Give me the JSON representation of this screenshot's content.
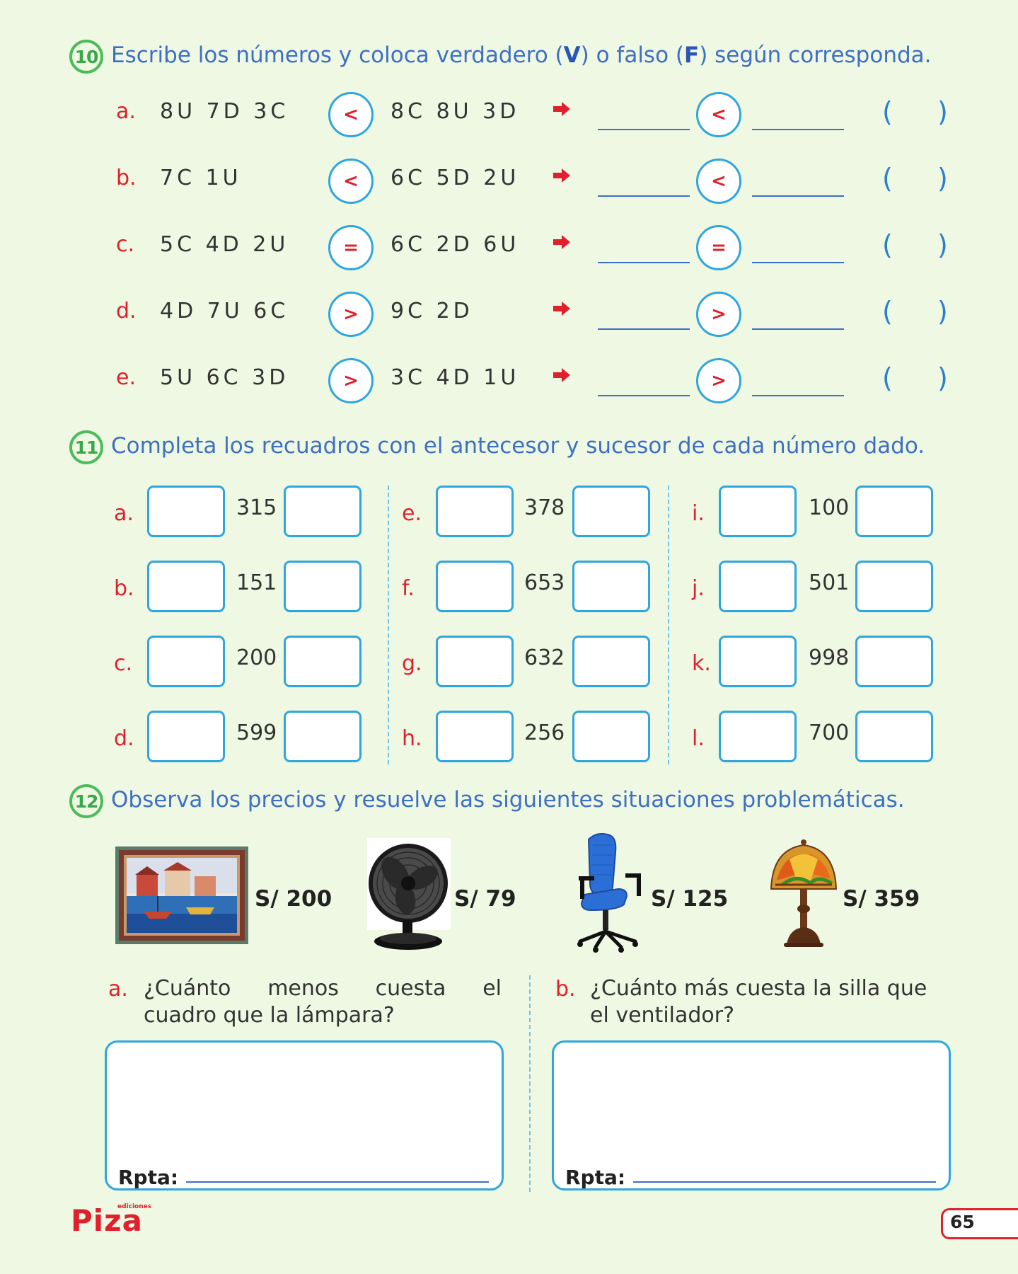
{
  "section10": {
    "number": "10",
    "title_pre": "Escribe los números y coloca verdadero (",
    "title_v": "V",
    "title_mid": ") o falso (",
    "title_f": "F",
    "title_post": ") según corresponda.",
    "rows": [
      {
        "letter": "a.",
        "left": "8U 7D 3C",
        "op": "<",
        "right": "8C 8U 3D",
        "op2": "<"
      },
      {
        "letter": "b.",
        "left": "7C 1U",
        "op": "<",
        "right": "6C 5D 2U",
        "op2": "<"
      },
      {
        "letter": "c.",
        "left": "5C 4D 2U",
        "op": "=",
        "right": "6C 2D 6U",
        "op2": "="
      },
      {
        "letter": "d.",
        "left": "4D 7U 6C",
        "op": ">",
        "right": "9C 2D",
        "op2": ">"
      },
      {
        "letter": "e.",
        "left": "5U 6C 3D",
        "op": ">",
        "right": "3C 4D 1U",
        "op2": ">"
      }
    ],
    "paren_open": "(",
    "paren_close": ")"
  },
  "section11": {
    "number": "11",
    "title": "Completa los recuadros con el antecesor y sucesor de cada número dado.",
    "items": [
      {
        "letter": "a.",
        "num": "315"
      },
      {
        "letter": "b.",
        "num": "151"
      },
      {
        "letter": "c.",
        "num": "200"
      },
      {
        "letter": "d.",
        "num": "599"
      },
      {
        "letter": "e.",
        "num": "378"
      },
      {
        "letter": "f.",
        "num": "653"
      },
      {
        "letter": "g.",
        "num": "632"
      },
      {
        "letter": "h.",
        "num": "256"
      },
      {
        "letter": "i.",
        "num": "100"
      },
      {
        "letter": "j.",
        "num": "501"
      },
      {
        "letter": "k.",
        "num": "998"
      },
      {
        "letter": "l.",
        "num": "700"
      }
    ]
  },
  "section12": {
    "number": "12",
    "title": "Observa los precios y resuelve las siguientes situaciones problemáticas.",
    "prices": [
      "S/ 200",
      "S/ 79",
      "S/ 125",
      "S/ 359"
    ],
    "q_a_letter": "a.",
    "q_a_line1_words": [
      "¿Cuánto",
      "menos",
      "cuesta",
      "el"
    ],
    "q_a_line2": "cuadro que la lámpara?",
    "q_b_letter": "b.",
    "q_b_line1": "¿Cuánto más cuesta la silla que",
    "q_b_line2": "el ventilador?",
    "rpta": "Rpta:"
  },
  "footer": {
    "logo": "Piza",
    "logo_small": "ediciones",
    "page": "65"
  },
  "colors": {
    "background": "#eef8e3",
    "accent_blue": "#2fa6dd",
    "title_blue": "#3d6fc4",
    "red": "#e0202c",
    "green": "#4cbb5a"
  }
}
